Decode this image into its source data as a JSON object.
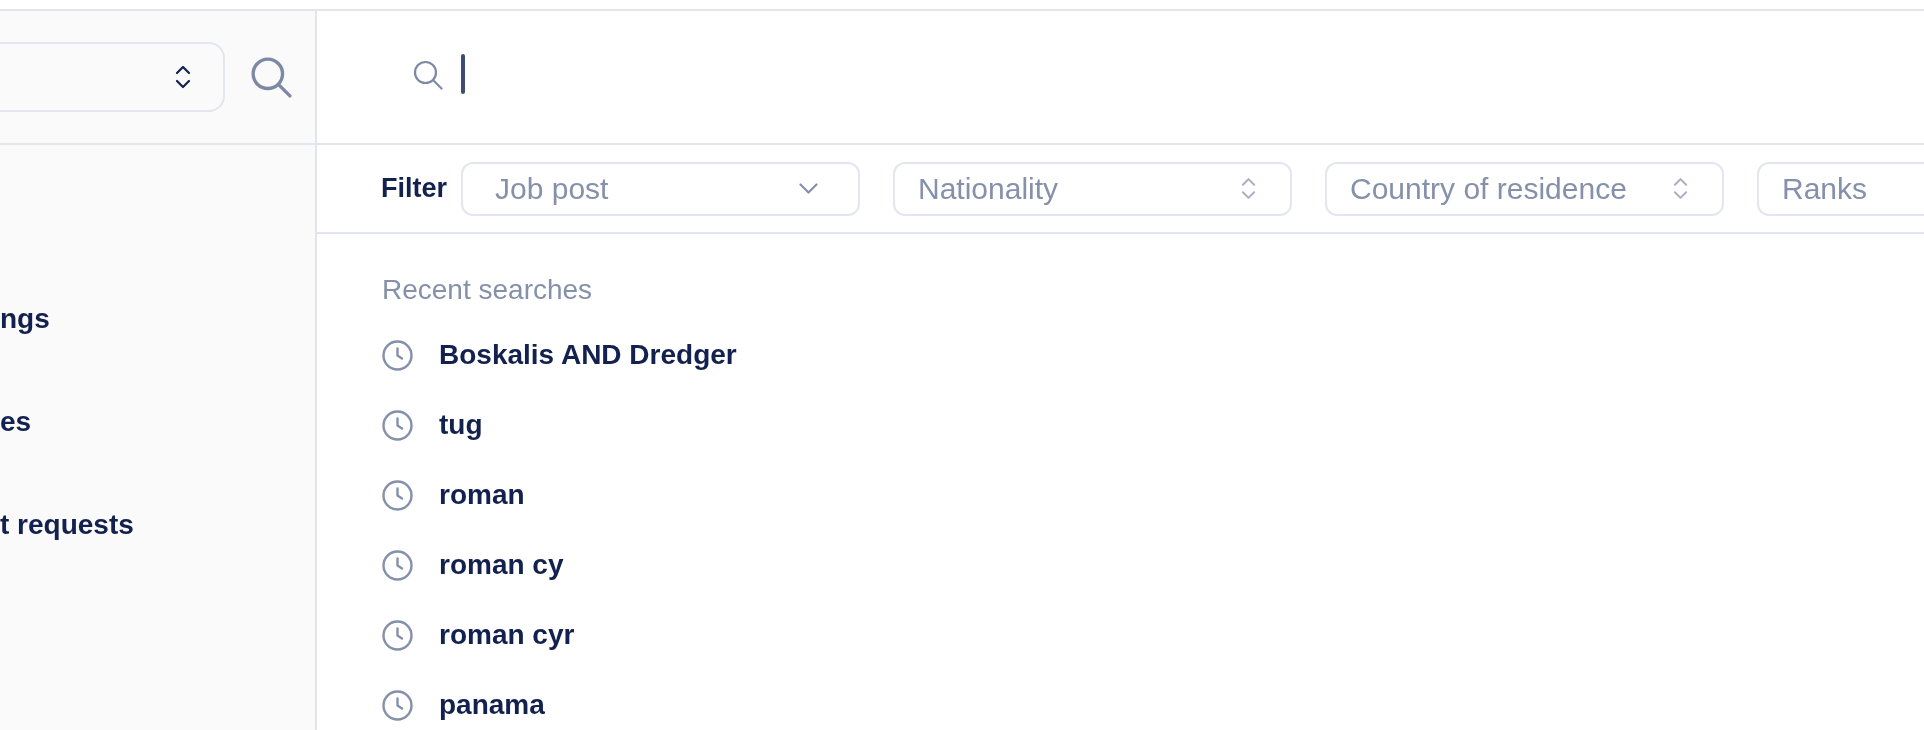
{
  "sidebar": {
    "items": [
      {
        "label": "ngs"
      },
      {
        "label": "es"
      },
      {
        "label": "t requests"
      }
    ]
  },
  "search": {
    "focused": true
  },
  "filter": {
    "label": "Filter",
    "selects": [
      {
        "kind": "dropdown",
        "placeholder": "Job post"
      },
      {
        "kind": "select",
        "placeholder": "Nationality"
      },
      {
        "kind": "select",
        "placeholder": "Country of residence"
      },
      {
        "kind": "plain",
        "placeholder": "Ranks"
      }
    ]
  },
  "recent_searches": {
    "title": "Recent searches",
    "items": [
      "Boskalis AND Dredger",
      "tug",
      "roman",
      "roman cy",
      "roman cyr",
      "panama"
    ]
  }
}
